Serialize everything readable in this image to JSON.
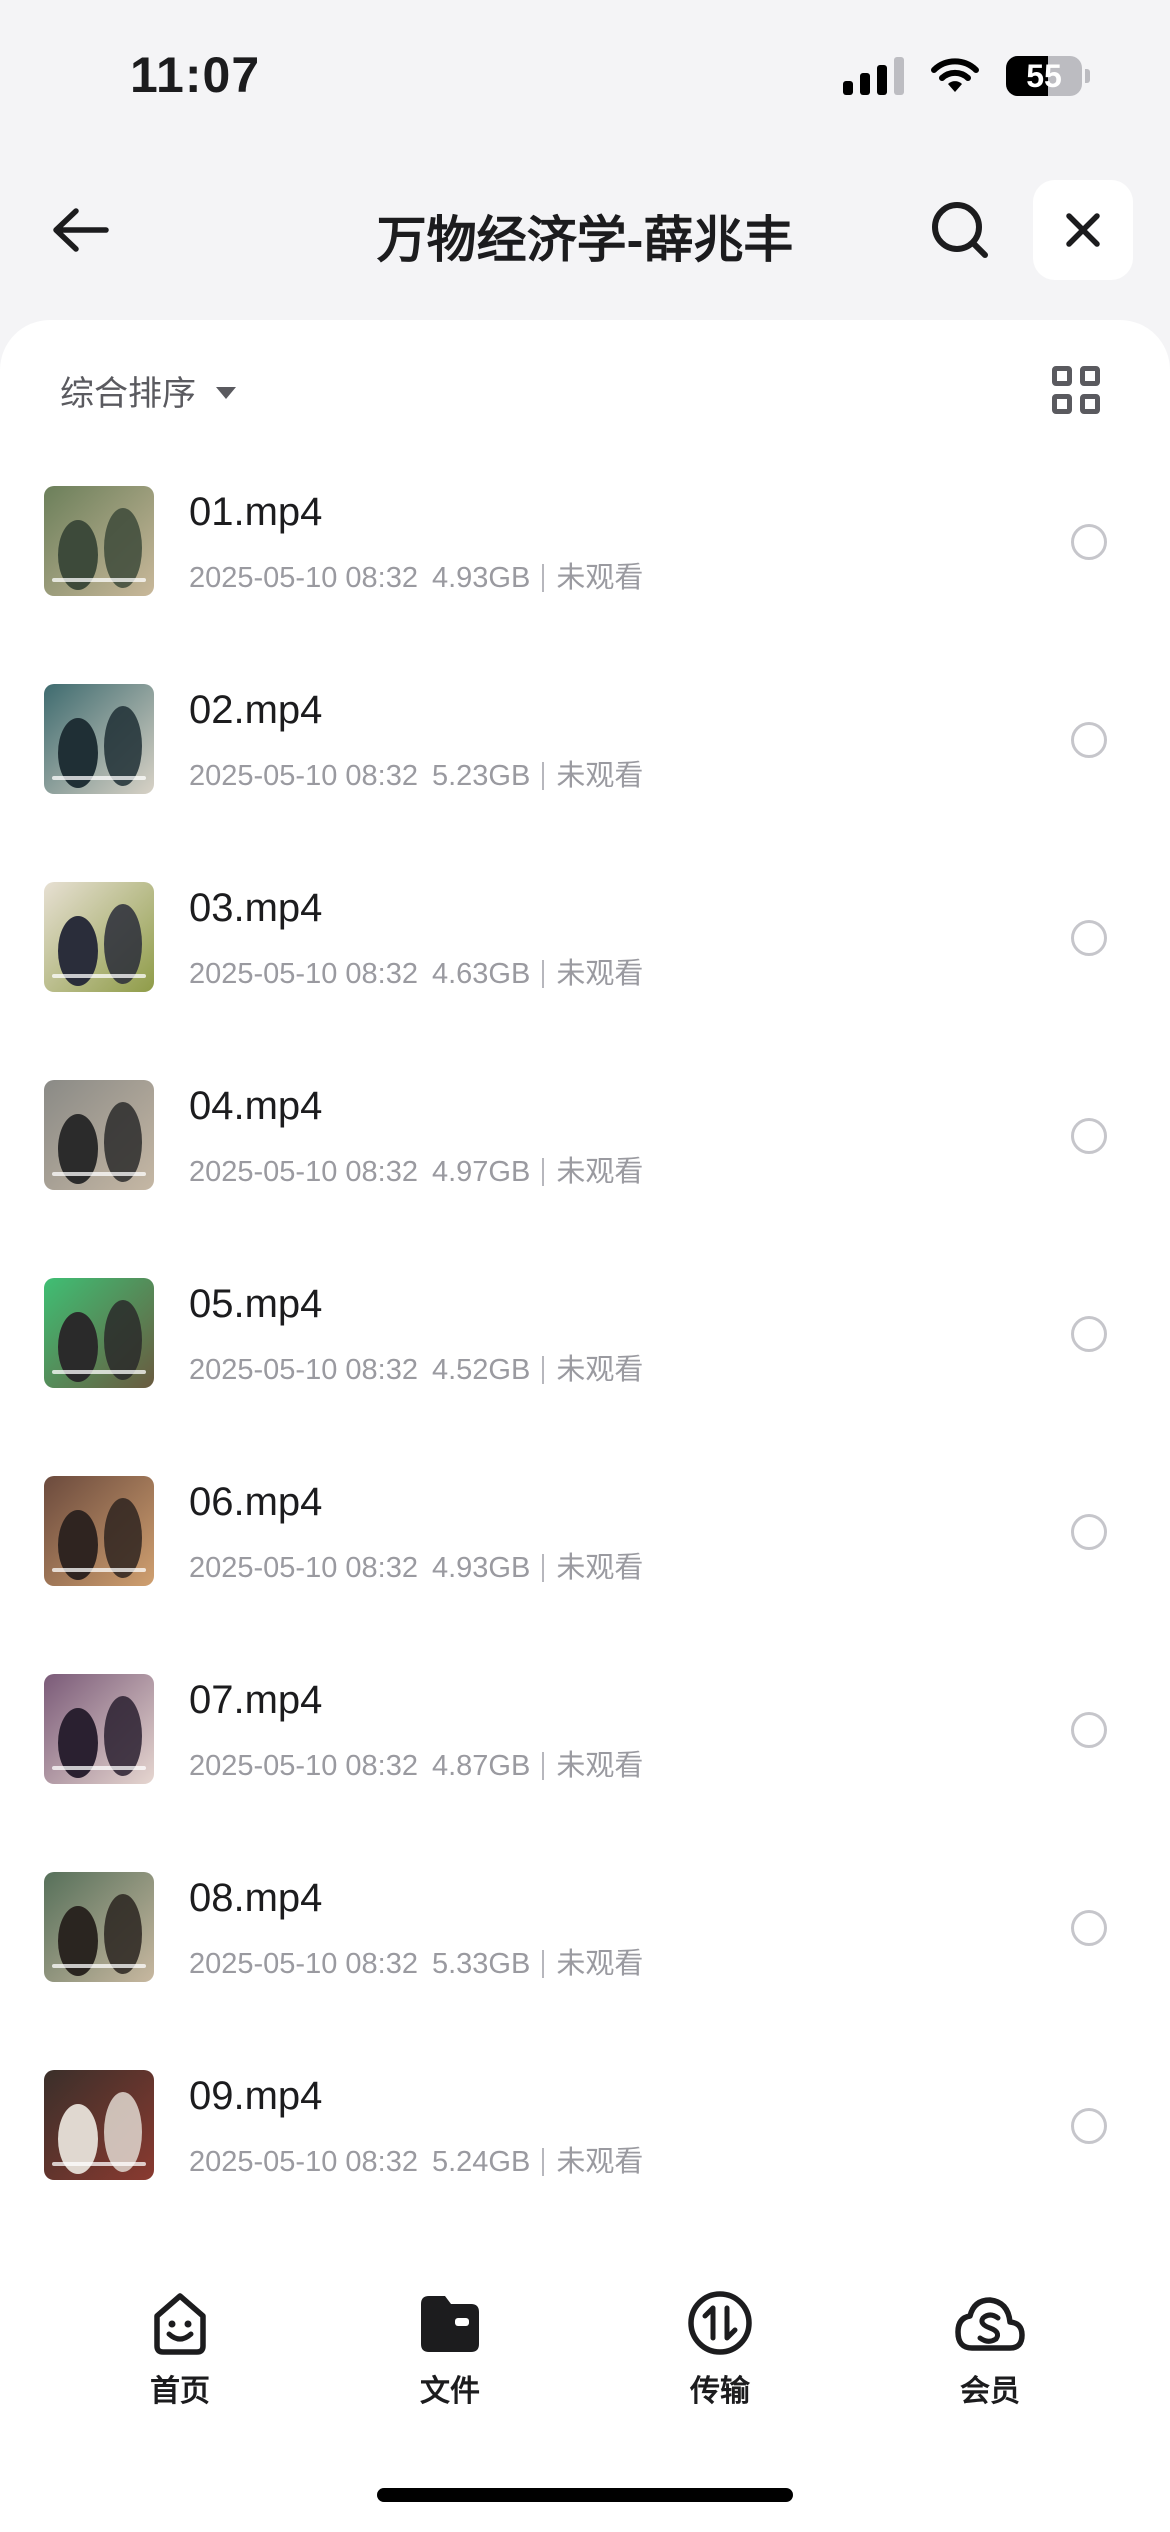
{
  "status_bar": {
    "time": "11:07",
    "battery": "55"
  },
  "header": {
    "title": "万物经济学-薛兆丰"
  },
  "toolbar": {
    "sort_label": "综合排序"
  },
  "files": [
    {
      "name": "01.mp4",
      "date": "2025-05-10 08:32",
      "size": "4.93GB",
      "status": "未观看",
      "thumb_colors": [
        "#6b7f5a",
        "#3d4a3a",
        "#c9b89a"
      ]
    },
    {
      "name": "02.mp4",
      "date": "2025-05-10 08:32",
      "size": "5.23GB",
      "status": "未观看",
      "thumb_colors": [
        "#3e6b6f",
        "#1f2f35",
        "#d8d2c6"
      ]
    },
    {
      "name": "03.mp4",
      "date": "2025-05-10 08:32",
      "size": "4.63GB",
      "status": "未观看",
      "thumb_colors": [
        "#e7e0d3",
        "#2a2d3a",
        "#8f9c48"
      ]
    },
    {
      "name": "04.mp4",
      "date": "2025-05-10 08:32",
      "size": "4.97GB",
      "status": "未观看",
      "thumb_colors": [
        "#8a8a86",
        "#2b2b2b",
        "#c5b7a4"
      ]
    },
    {
      "name": "05.mp4",
      "date": "2025-05-10 08:32",
      "size": "4.52GB",
      "status": "未观看",
      "thumb_colors": [
        "#3fbf74",
        "#2a2a2a",
        "#6a5a3f"
      ]
    },
    {
      "name": "06.mp4",
      "date": "2025-05-10 08:32",
      "size": "4.93GB",
      "status": "未观看",
      "thumb_colors": [
        "#6b4a3d",
        "#2f2420",
        "#d0a070"
      ]
    },
    {
      "name": "07.mp4",
      "date": "2025-05-10 08:32",
      "size": "4.87GB",
      "status": "未观看",
      "thumb_colors": [
        "#7a5a78",
        "#2a2030",
        "#e6d6d0"
      ]
    },
    {
      "name": "08.mp4",
      "date": "2025-05-10 08:32",
      "size": "5.33GB",
      "status": "未观看",
      "thumb_colors": [
        "#56705a",
        "#2a2520",
        "#c8b8a0"
      ]
    },
    {
      "name": "09.mp4",
      "date": "2025-05-10 08:32",
      "size": "5.24GB",
      "status": "未观看",
      "thumb_colors": [
        "#3a2f2a",
        "#e0d8d0",
        "#8a3a30"
      ]
    }
  ],
  "nav": {
    "items": [
      {
        "label": "首页",
        "icon": "smiley-box-icon"
      },
      {
        "label": "文件",
        "icon": "folder-icon"
      },
      {
        "label": "传输",
        "icon": "transfer-icon"
      },
      {
        "label": "会员",
        "icon": "cloud-s-icon"
      }
    ]
  }
}
